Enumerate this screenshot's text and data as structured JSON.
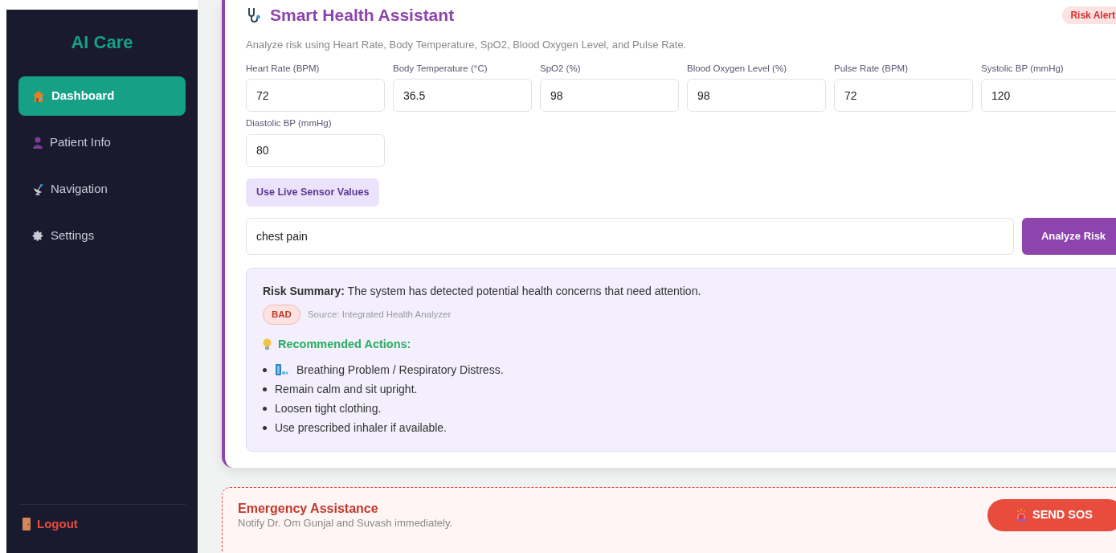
{
  "sidebar": {
    "logo": "AI Care",
    "items": [
      {
        "label": "Dashboard",
        "kind": "house",
        "selected": true
      },
      {
        "label": "Patient Info",
        "kind": "person",
        "selected": false
      },
      {
        "label": "Navigation",
        "kind": "dish",
        "selected": false
      },
      {
        "label": "Settings",
        "kind": "gear",
        "selected": false
      }
    ],
    "logout": "Logout"
  },
  "assistant": {
    "title": "Smart Health Assistant",
    "badge": "Risk Alert",
    "description": "Analyze risk using Heart Rate, Body Temperature, SpO2, Blood Oxygen Level, and Pulse Rate.",
    "fields": [
      {
        "label": "Heart Rate (BPM)",
        "value": "72"
      },
      {
        "label": "Body Temperature (°C)",
        "value": "36.5"
      },
      {
        "label": "SpO2 (%)",
        "value": "98"
      },
      {
        "label": "Blood Oxygen Level (%)",
        "value": "98"
      },
      {
        "label": "Pulse Rate (BPM)",
        "value": "72"
      },
      {
        "label": "Systolic BP (mmHg)",
        "value": "120"
      },
      {
        "label": "Diastolic BP (mmHg)",
        "value": "80"
      }
    ],
    "live_button": "Use Live Sensor Values",
    "symptoms": "chest pain",
    "analyze_button": "Analyze Risk",
    "result": {
      "summary": "**Risk Summary:** The system has detected potential health concerns that need attention.",
      "status": "BAD",
      "source": "Source: Integrated Health Analyzer",
      "actions_title": "Recommended Actions:",
      "actions": [
        {
          "text": "Breathing Problem / Respiratory Distress.",
          "kind": "breath"
        },
        {
          "text": "Remain calm and sit upright.",
          "kind": "plain"
        },
        {
          "text": "Loosen tight clothing.",
          "kind": "plain"
        },
        {
          "text": "Use prescribed inhaler if available.",
          "kind": "plain"
        }
      ]
    }
  },
  "emergency": {
    "title": "Emergency Assistance",
    "description": "Notify Dr. Om Gunjal and Suvash immediately.",
    "button": "SEND SOS"
  }
}
